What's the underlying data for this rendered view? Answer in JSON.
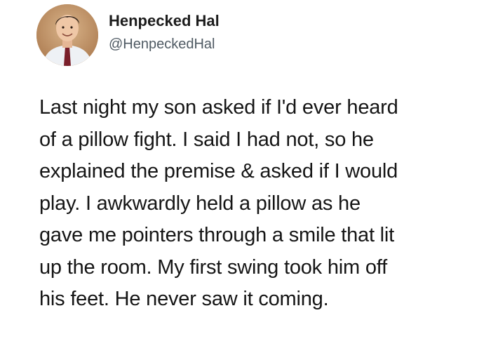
{
  "author": {
    "display_name": "Henpecked Hal",
    "handle": "@HenpeckedHal",
    "avatar_icon": "profile-photo-icon"
  },
  "tweet": {
    "lines": [
      "Last night my son asked if I'd ever heard",
      "of a pillow fight. I said I had not, so he",
      "explained the premise & asked if I would",
      "play. I awkwardly held a pillow as he",
      "gave me pointers through a smile that lit",
      "up the room. My first swing took him off",
      "his feet. He never saw it coming."
    ]
  },
  "colors": {
    "background": "#ffffff",
    "text": "#151515",
    "handle": "#4f5a63"
  }
}
